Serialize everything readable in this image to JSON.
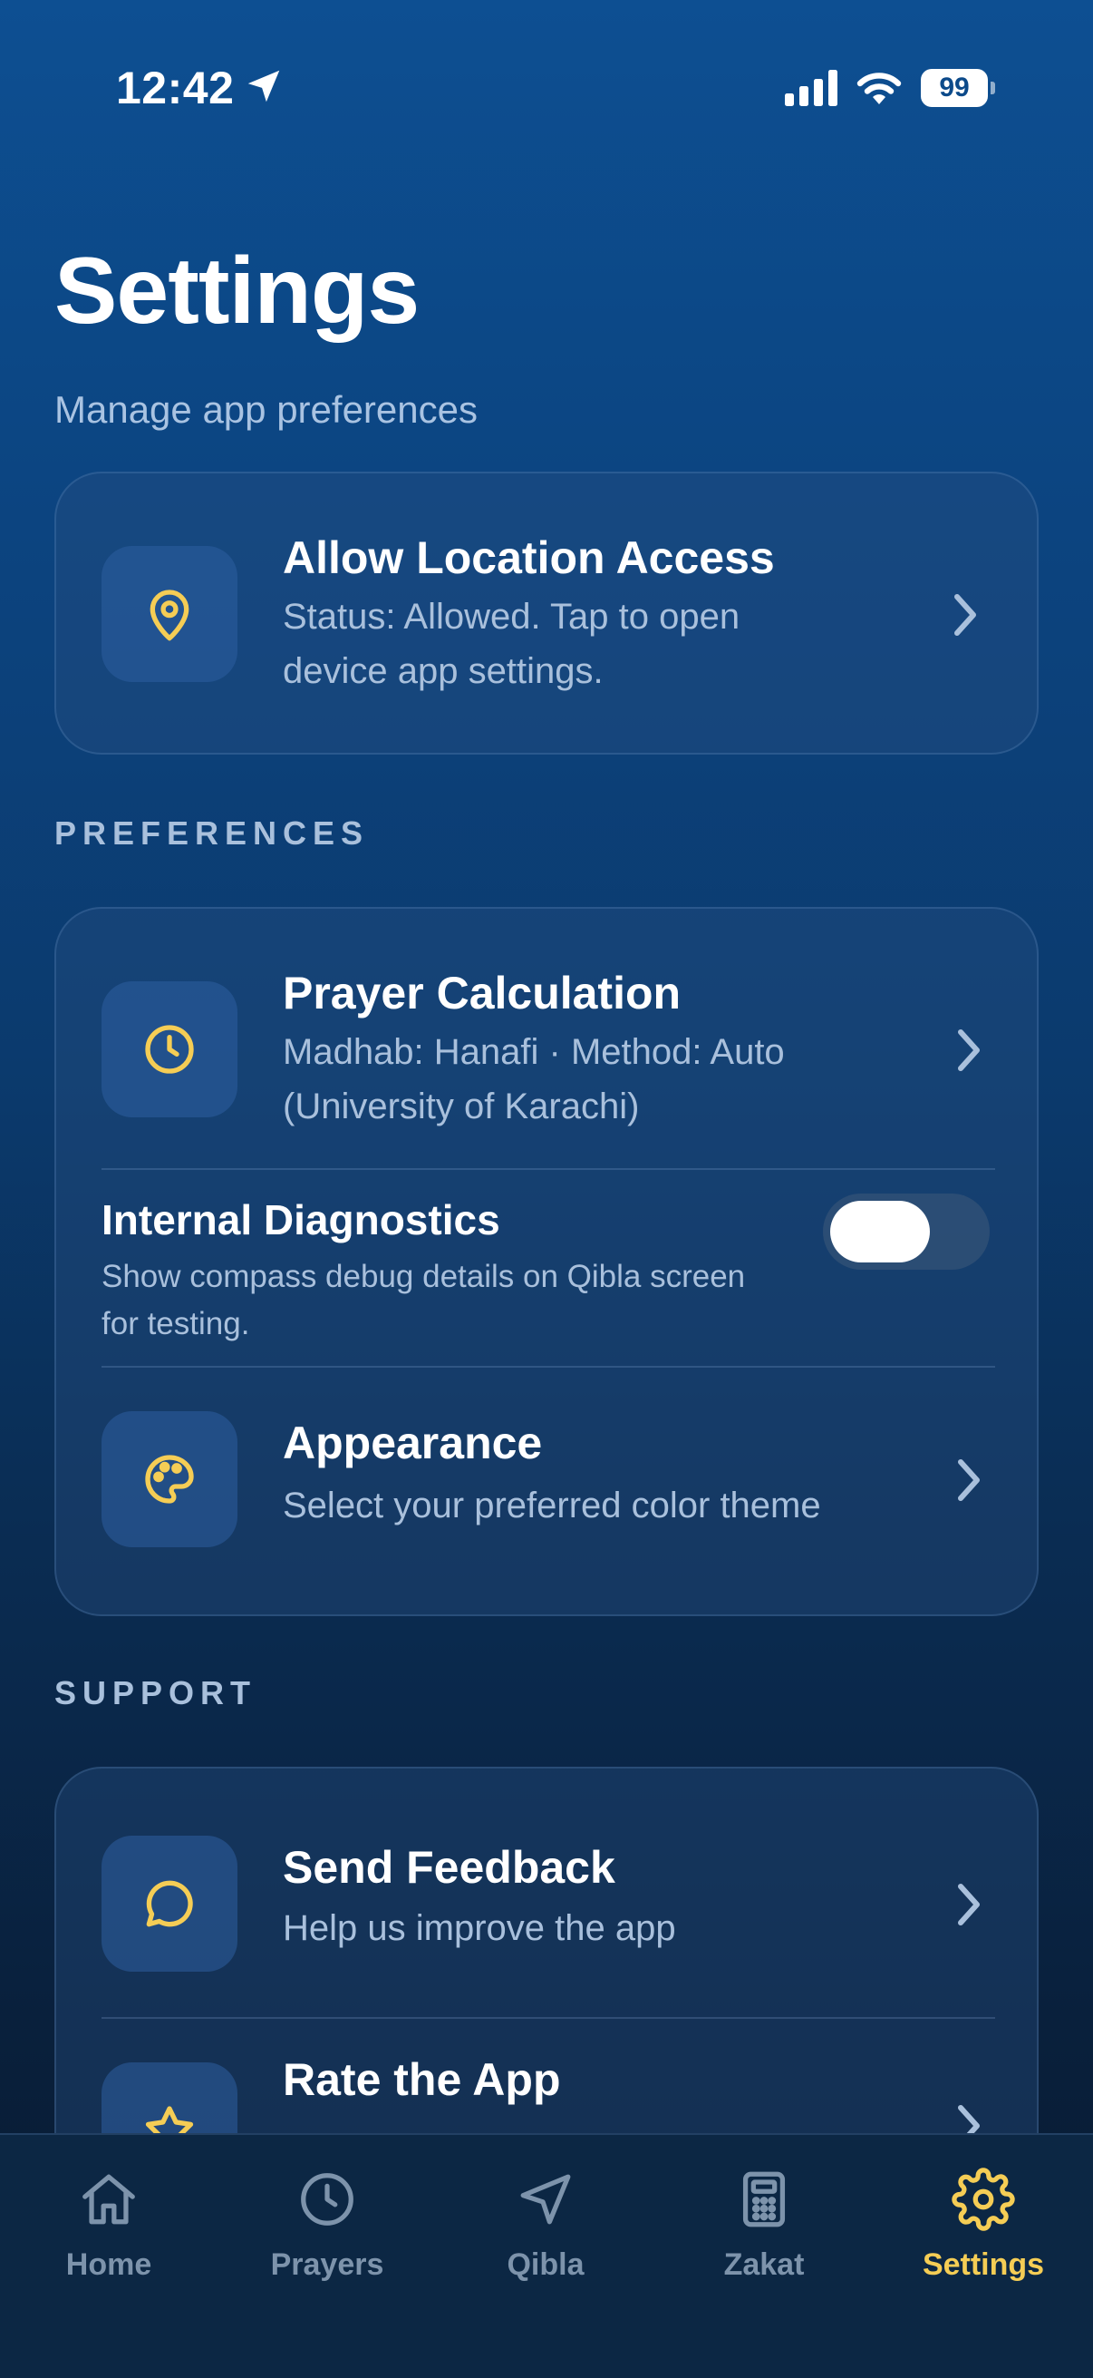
{
  "status_bar": {
    "time": "12:42",
    "battery": "99"
  },
  "header": {
    "title": "Settings",
    "subtitle": "Manage app preferences"
  },
  "location_card": {
    "title": "Allow Location Access",
    "subtitle": "Status: Allowed. Tap to open device app settings.",
    "icon": "map-pin-icon"
  },
  "preferences": {
    "section_label": "PREFERENCES",
    "prayer_calculation": {
      "title": "Prayer Calculation",
      "subtitle": "Madhab: Hanafi · Method: Auto (University of Karachi)",
      "icon": "clock-icon"
    },
    "internal_diagnostics": {
      "title": "Internal Diagnostics",
      "subtitle": "Show compass debug details on Qibla screen for testing.",
      "enabled": false
    },
    "appearance": {
      "title": "Appearance",
      "subtitle": "Select your preferred color theme",
      "icon": "palette-icon"
    }
  },
  "support": {
    "section_label": "SUPPORT",
    "send_feedback": {
      "title": "Send Feedback",
      "subtitle": "Help us improve the app",
      "icon": "chat-bubble-icon"
    },
    "rate_app": {
      "title": "Rate the App",
      "icon": "star-icon"
    }
  },
  "tab_bar": {
    "tabs": [
      {
        "label": "Home",
        "icon": "home-icon"
      },
      {
        "label": "Prayers",
        "icon": "clock-icon"
      },
      {
        "label": "Qibla",
        "icon": "navigation-arrow-icon"
      },
      {
        "label": "Zakat",
        "icon": "calculator-icon"
      },
      {
        "label": "Settings",
        "icon": "gear-icon",
        "active": true
      }
    ]
  },
  "colors": {
    "accent": "#f5cd55",
    "background_top": "#0d4f92",
    "background_bottom": "#081a30"
  }
}
